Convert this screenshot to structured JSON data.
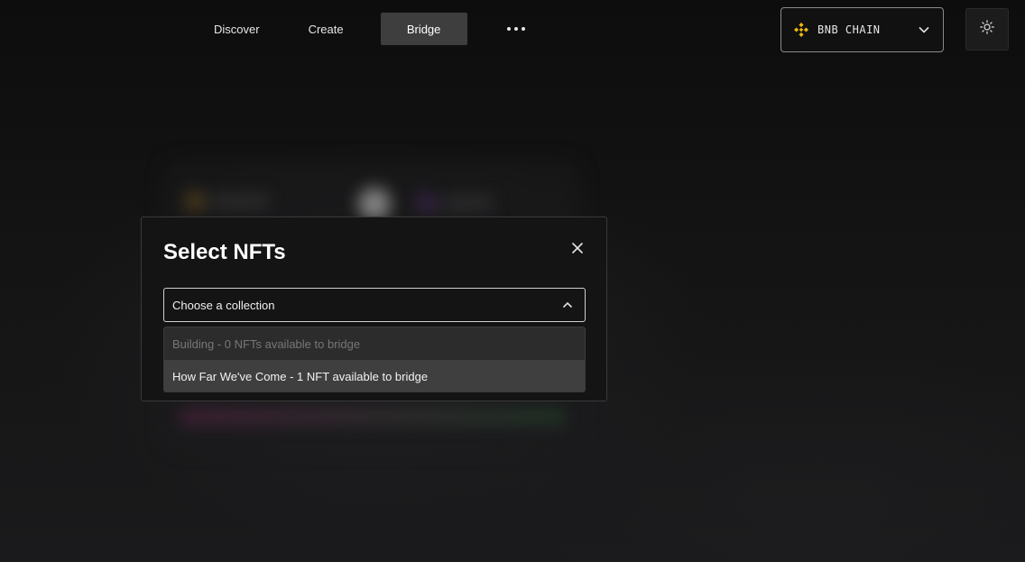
{
  "nav": {
    "items": [
      {
        "label": "Discover"
      },
      {
        "label": "Create"
      },
      {
        "label": "Bridge",
        "active": true
      }
    ],
    "more_icon": "more-horizontal-icon"
  },
  "chain_selector": {
    "label": "BNB CHAIN",
    "logo_icon": "bnb-logo-icon",
    "logo_color": "#f0b90b",
    "chevron_icon": "chevron-down-icon"
  },
  "theme_toggle": {
    "icon": "sun-icon"
  },
  "modal": {
    "title": "Select NFTs",
    "close_icon": "close-icon",
    "select": {
      "value": "Choose a collection",
      "chevron_icon": "chevron-up-icon",
      "expanded": true
    },
    "options": [
      {
        "label": "Building - 0 NFTs available to bridge",
        "disabled": true
      },
      {
        "label": "How Far We've Come - 1 NFT available to bridge",
        "disabled": false
      }
    ]
  },
  "colors": {
    "background": "#121212",
    "modal_bg": "#141414",
    "active_tab": "#3e3e3e",
    "bnb_yellow": "#f0b90b"
  }
}
